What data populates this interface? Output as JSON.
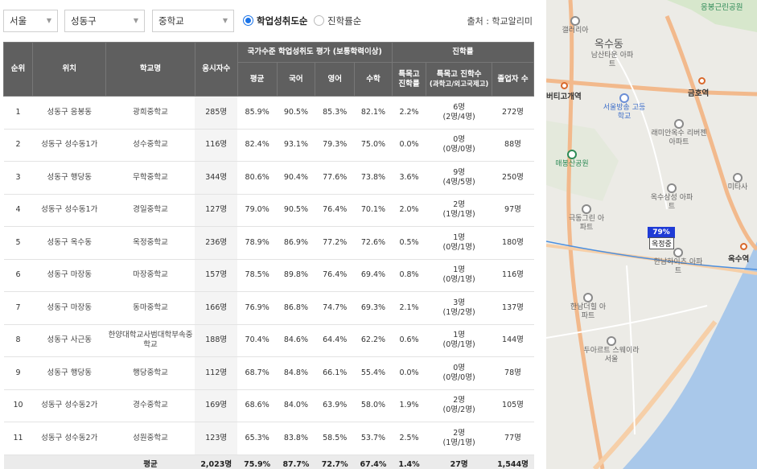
{
  "filters": {
    "region": "서울",
    "district": "성동구",
    "level": "중학교",
    "sort_options": [
      "학업성취도순",
      "진학률순"
    ],
    "source": "출처 : 학교알리미"
  },
  "table": {
    "headers": {
      "rank": "순위",
      "location": "위치",
      "school": "학교명",
      "takers": "응시자수",
      "achievement_group": "국가수준 학업성취도 평가 (보통학력이상)",
      "avg": "평균",
      "korean": "국어",
      "english": "영어",
      "math": "수학",
      "advancement_group": "진학률",
      "special_rate": "특목고 진학률",
      "special_count": "특목고 진학수",
      "special_count_sub": "(과학고/외고국제고)",
      "graduates": "졸업자 수"
    },
    "rows": [
      {
        "rank": "1",
        "location": "성동구 응봉동",
        "school": "광희중학교",
        "takers": "285명",
        "avg": "85.9%",
        "korean": "90.5%",
        "english": "85.3%",
        "math": "82.1%",
        "rate": "2.2%",
        "count": "6명",
        "count_detail": "(2명/4명)",
        "grads": "272명"
      },
      {
        "rank": "2",
        "location": "성동구 성수동1가",
        "school": "성수중학교",
        "takers": "116명",
        "avg": "82.4%",
        "korean": "93.1%",
        "english": "79.3%",
        "math": "75.0%",
        "rate": "0.0%",
        "count": "0명",
        "count_detail": "(0명/0명)",
        "grads": "88명"
      },
      {
        "rank": "3",
        "location": "성동구 행당동",
        "school": "무학중학교",
        "takers": "344명",
        "avg": "80.6%",
        "korean": "90.4%",
        "english": "77.6%",
        "math": "73.8%",
        "rate": "3.6%",
        "count": "9명",
        "count_detail": "(4명/5명)",
        "grads": "250명"
      },
      {
        "rank": "4",
        "location": "성동구 성수동1가",
        "school": "경일중학교",
        "takers": "127명",
        "avg": "79.0%",
        "korean": "90.5%",
        "english": "76.4%",
        "math": "70.1%",
        "rate": "2.0%",
        "count": "2명",
        "count_detail": "(1명/1명)",
        "grads": "97명"
      },
      {
        "rank": "5",
        "location": "성동구 옥수동",
        "school": "옥정중학교",
        "takers": "236명",
        "avg": "78.9%",
        "korean": "86.9%",
        "english": "77.2%",
        "math": "72.6%",
        "rate": "0.5%",
        "count": "1명",
        "count_detail": "(0명/1명)",
        "grads": "180명"
      },
      {
        "rank": "6",
        "location": "성동구 마장동",
        "school": "마장중학교",
        "takers": "157명",
        "avg": "78.5%",
        "korean": "89.8%",
        "english": "76.4%",
        "math": "69.4%",
        "rate": "0.8%",
        "count": "1명",
        "count_detail": "(0명/1명)",
        "grads": "116명"
      },
      {
        "rank": "7",
        "location": "성동구 마장동",
        "school": "동마중학교",
        "takers": "166명",
        "avg": "76.9%",
        "korean": "86.8%",
        "english": "74.7%",
        "math": "69.3%",
        "rate": "2.1%",
        "count": "3명",
        "count_detail": "(1명/2명)",
        "grads": "137명"
      },
      {
        "rank": "8",
        "location": "성동구 사근동",
        "school": "한양대학교사범대학부속중학교",
        "takers": "188명",
        "avg": "70.4%",
        "korean": "84.6%",
        "english": "64.4%",
        "math": "62.2%",
        "rate": "0.6%",
        "count": "1명",
        "count_detail": "(0명/1명)",
        "grads": "144명"
      },
      {
        "rank": "9",
        "location": "성동구 행당동",
        "school": "행당중학교",
        "takers": "112명",
        "avg": "68.7%",
        "korean": "84.8%",
        "english": "66.1%",
        "math": "55.4%",
        "rate": "0.0%",
        "count": "0명",
        "count_detail": "(0명/0명)",
        "grads": "78명"
      },
      {
        "rank": "10",
        "location": "성동구 성수동2가",
        "school": "경수중학교",
        "takers": "169명",
        "avg": "68.6%",
        "korean": "84.0%",
        "english": "63.9%",
        "math": "58.0%",
        "rate": "1.9%",
        "count": "2명",
        "count_detail": "(0명/2명)",
        "grads": "105명"
      },
      {
        "rank": "11",
        "location": "성동구 성수동2가",
        "school": "성원중학교",
        "takers": "123명",
        "avg": "65.3%",
        "korean": "83.8%",
        "english": "58.5%",
        "math": "53.7%",
        "rate": "2.5%",
        "count": "2명",
        "count_detail": "(1명/1명)",
        "grads": "77명"
      }
    ],
    "average": {
      "label": "평균",
      "takers": "2,023명",
      "avg": "75.9%",
      "korean": "87.7%",
      "english": "72.7%",
      "math": "67.4%",
      "rate": "1.4%",
      "count": "27명",
      "grads": "1,544명"
    }
  },
  "map": {
    "labels": {
      "galleria": "갤러리아",
      "oksu_dong": "옥수동",
      "namsan_town": "남산타운 아파트",
      "geumho_st": "금호역",
      "bt_gojae": "버티고개역",
      "seoul_bangsong": "서울방송 고등학교",
      "raemian_oksu": "래미안옥수 리버젠아파트",
      "maebongsan": "매봉산공원",
      "oksu_samsung": "옥수삼성 아파트",
      "geukdong": "극동그린 아파트",
      "hannam_heights": "한남하이츠 아파트",
      "hannam_the_hill": "한남더힐 아파트",
      "two_apart": "두아르트 스웨이라 서울",
      "oksu_st": "옥수역",
      "mitasa": "미타사",
      "eungbong_park": "응봉근린공원"
    },
    "marker": {
      "value": "79%",
      "name": "옥정중"
    }
  }
}
